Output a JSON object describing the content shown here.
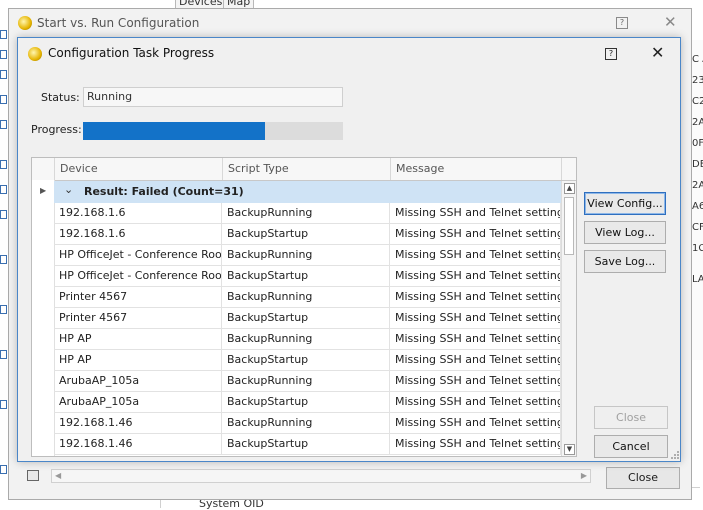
{
  "background": {
    "tabs": [
      "Devices",
      "Map"
    ],
    "right_column": [
      "C A",
      "23",
      "C2",
      "2A",
      "0F",
      "DE",
      "2A",
      "A6",
      "CF",
      "1C",
      "LA"
    ],
    "bottom_label": "System OID"
  },
  "outer_window": {
    "title": "Start vs. Run Configuration",
    "help_icon": "help-icon",
    "close_glyph": "✕",
    "close_button": "Close"
  },
  "dialog": {
    "title": "Configuration Task Progress",
    "help_glyph": "?",
    "close_glyph": "✕",
    "status_label": "Status:",
    "status_value": "Running",
    "progress_label": "Progress:",
    "progress_fraction": 0.7,
    "grid": {
      "columns": [
        "Device",
        "Script Type",
        "Message"
      ],
      "group_label": "Result: Failed (Count=31)",
      "rows": [
        {
          "device": "192.168.1.6",
          "script": "BackupRunning",
          "message": "Missing SSH and Telnet settings"
        },
        {
          "device": "192.168.1.6",
          "script": "BackupStartup",
          "message": "Missing SSH and Telnet settings"
        },
        {
          "device": "HP OfficeJet - Conference Room",
          "script": "BackupRunning",
          "message": "Missing SSH and Telnet settings"
        },
        {
          "device": "HP OfficeJet - Conference Room",
          "script": "BackupStartup",
          "message": "Missing SSH and Telnet settings"
        },
        {
          "device": "Printer 4567",
          "script": "BackupRunning",
          "message": "Missing SSH and Telnet settings"
        },
        {
          "device": "Printer 4567",
          "script": "BackupStartup",
          "message": "Missing SSH and Telnet settings"
        },
        {
          "device": "HP AP",
          "script": "BackupRunning",
          "message": "Missing SSH and Telnet settings"
        },
        {
          "device": "HP AP",
          "script": "BackupStartup",
          "message": "Missing SSH and Telnet settings"
        },
        {
          "device": "ArubaAP_105a",
          "script": "BackupRunning",
          "message": "Missing SSH and Telnet settings"
        },
        {
          "device": "ArubaAP_105a",
          "script": "BackupStartup",
          "message": "Missing SSH and Telnet settings"
        },
        {
          "device": "192.168.1.46",
          "script": "BackupRunning",
          "message": "Missing SSH and Telnet settings"
        },
        {
          "device": "192.168.1.46",
          "script": "BackupStartup",
          "message": "Missing SSH and Telnet settings"
        }
      ]
    },
    "buttons": {
      "view_config": "View Config...",
      "view_log": "View Log...",
      "save_log": "Save Log...",
      "close": "Close",
      "cancel": "Cancel"
    }
  },
  "colors": {
    "progress_fill": "#1372c8",
    "group_row": "#cfe3f5",
    "dialog_border": "#4a86c8"
  }
}
